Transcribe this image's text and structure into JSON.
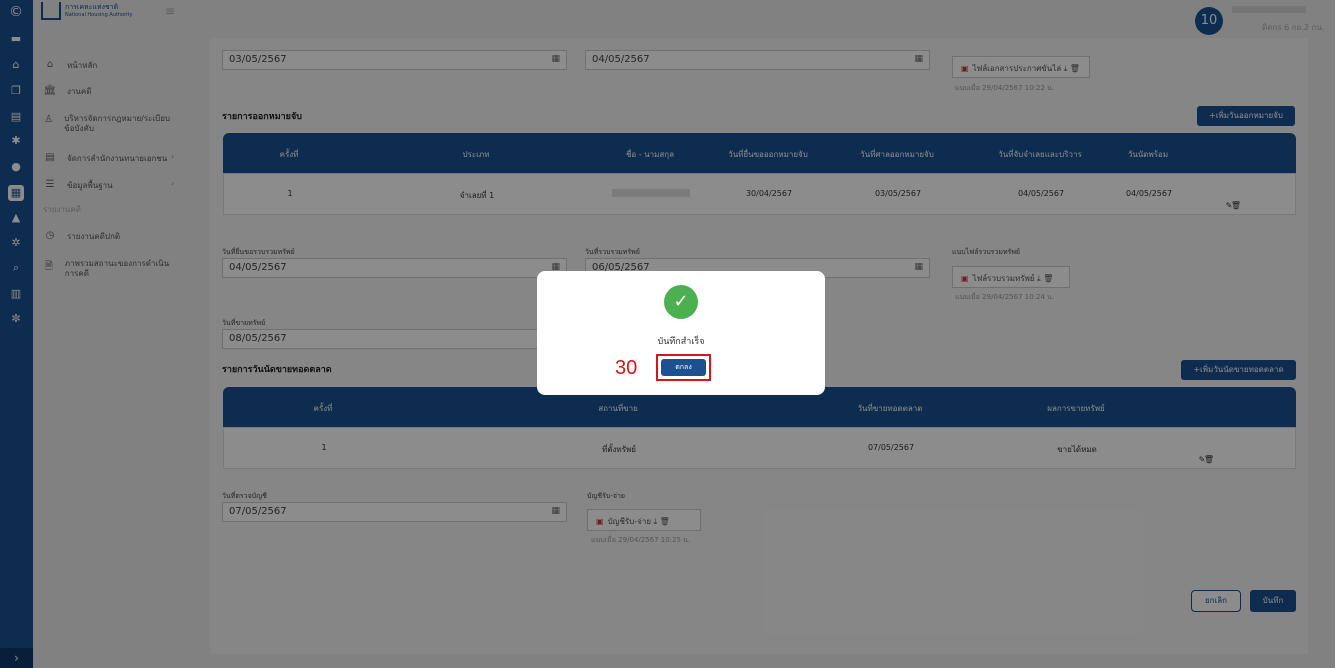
{
  "app": {
    "logo_text_1": "การเคหะแห่งชาติ",
    "logo_text_2": "National Housing Authority",
    "menu_icon": "hamburger-icon"
  },
  "user": {
    "avatar": "10",
    "subtitle": "ติดกร 6 กอ.2 กน."
  },
  "sidebar": {
    "items": [
      {
        "label": "หน้าหลัก",
        "icon": "home-icon"
      },
      {
        "label": "งานคดี",
        "icon": "bank-icon"
      },
      {
        "label": "บริหารจัดการกฎหมาย/ระเบียบข้อบังคับ",
        "icon": "person-icon"
      },
      {
        "label": "จัดการสำนักงานทนายเอกชน",
        "icon": "document-icon"
      },
      {
        "label": "ข้อมูลพื้นฐาน",
        "icon": "list-icon"
      }
    ],
    "report_header": "รายงานคดี",
    "report_items": [
      {
        "label": "รายงานคดีปกติ",
        "icon": "clock-icon"
      },
      {
        "label": "ภาพรวมสถานะของการดำเนินการคดี",
        "icon": "file-icon"
      }
    ]
  },
  "top": {
    "date1": "03/05/2567",
    "date2": "04/05/2567",
    "attach_label": "ไฟล์เอกสารประกาศขันไล่",
    "attach_note": "แนบเมื่อ 29/04/2567 10:22 น."
  },
  "warrant": {
    "title": "รายการออกหมายจับ",
    "add_button": "+เพิ่มวันออกหมายจับ",
    "columns": [
      "ครั้งที่",
      "ประเภท",
      "ชื่อ - นามสกุล",
      "วันที่ยื่นขอออกหมายจับ",
      "วันที่ศาลออกหมายจับ",
      "วันที่จับจำเลยและบริวาร",
      "วันนัดพร้อม"
    ],
    "rows": [
      [
        "1",
        "จำเลยที่ 1",
        "",
        "30/04/2567",
        "03/05/2567",
        "04/05/2567",
        "04/05/2567"
      ]
    ]
  },
  "assets": {
    "label1": "วันที่ยื่นขอรวบรวมทรัพย์",
    "value1": "04/05/2567",
    "label2": "วันที่รวบรวมทรัพย์",
    "value2": "06/05/2567",
    "attach_title": "แนบไฟล์รวบรวมทรัพย์",
    "attach_label": "ไฟล์รวบรวมทรัพย์",
    "attach_note": "แนบเมื่อ 29/04/2567 10:24 น.",
    "label3": "วันที่ขายทรัพย์",
    "value3": "08/05/2567"
  },
  "auction": {
    "title": "รายการวันนัดขายทอดตลาด",
    "add_button": "+เพิ่มวันนัดขายทอดตลาด",
    "columns": [
      "ครั้งที่",
      "สถานที่ขาย",
      "วันที่ขายทอดตลาด",
      "ผลการขายทรัพย์"
    ],
    "rows": [
      [
        "1",
        "ที่ตั้งทรัพย์",
        "07/05/2567",
        "ขายได้หมด"
      ]
    ]
  },
  "accounting": {
    "label1": "วันที่ตรวจบัญชี",
    "value1": "07/05/2567",
    "label2": "บัญชีรับ-จ่าย",
    "attach_label": "บัญชีรับ-จ่าย",
    "attach_note": "แนบเมื่อ 29/04/2567 10:25 น."
  },
  "footer": {
    "cancel": "ยกเลิก",
    "save": "บันทึก"
  },
  "modal": {
    "message": "บันทึกสำเร็จ",
    "ok": "ตกลง",
    "step": "30"
  },
  "colors": {
    "primary": "#1b5091",
    "success": "#4caf50",
    "highlight": "#d9141b"
  }
}
